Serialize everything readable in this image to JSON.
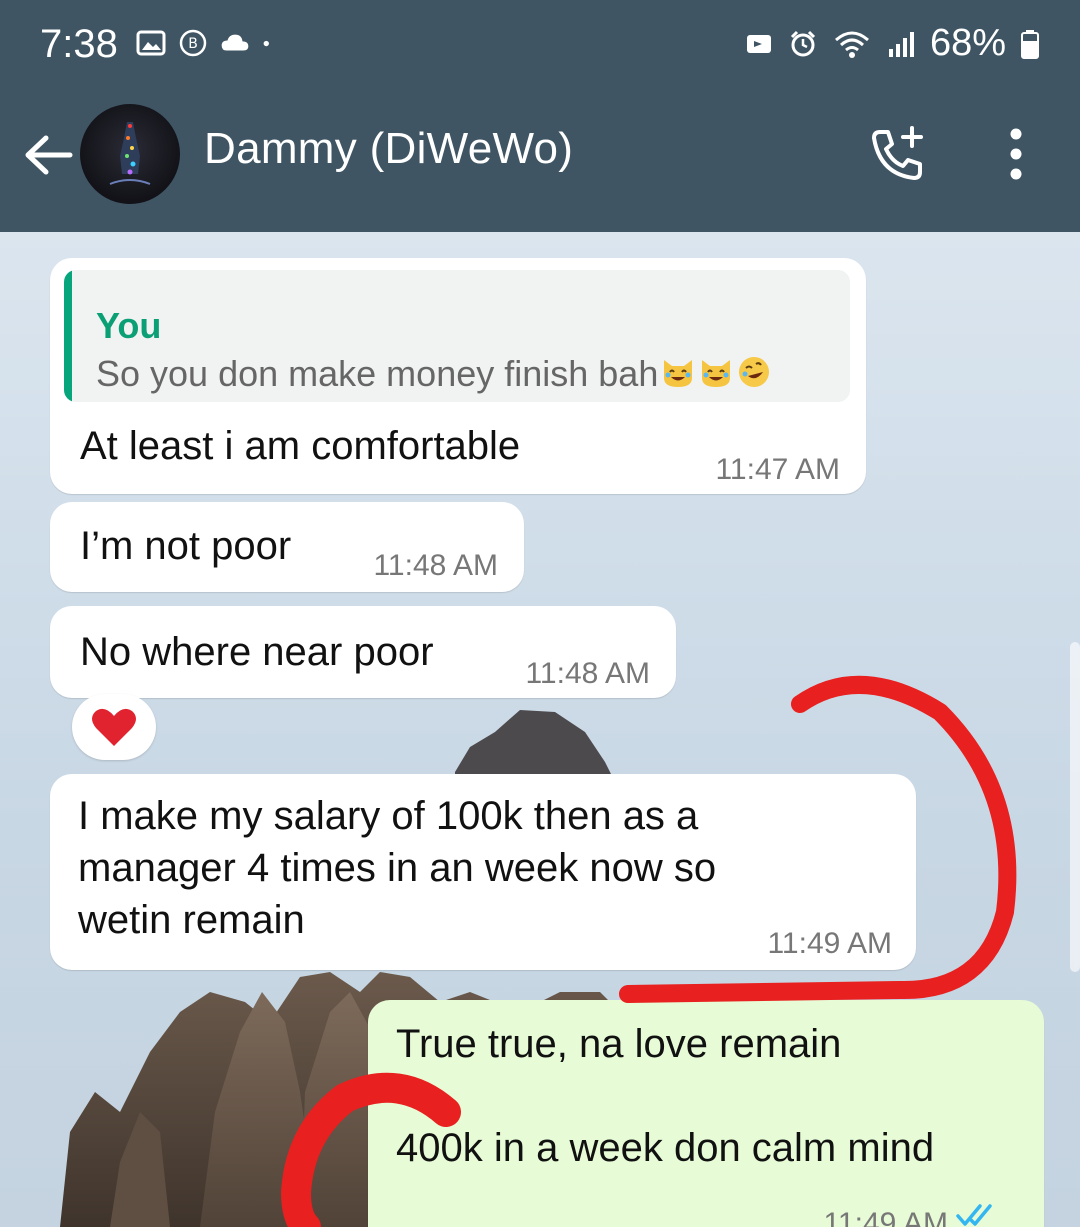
{
  "status_bar": {
    "time": "7:38",
    "left_icons": [
      "gallery-icon",
      "b-circle-icon",
      "cloud-icon",
      "dot-icon"
    ],
    "right_icons": [
      "notification-icon",
      "alarm-icon",
      "wifi-icon",
      "signal-icon"
    ],
    "battery_text": "68%"
  },
  "header": {
    "contact_name": "Dammy (DiWeWo)",
    "actions": [
      "call-add-icon",
      "menu-dots-icon"
    ]
  },
  "messages": [
    {
      "direction": "incoming",
      "quote": {
        "author": "You",
        "text": "So you don make money finish bah",
        "emojis": [
          "joy-cat-icon",
          "joy-cat-icon",
          "rolling-laugh-icon"
        ]
      },
      "text": "At least i am comfortable",
      "time": "11:47 AM"
    },
    {
      "direction": "incoming",
      "text": "I’m not poor",
      "time": "11:48 AM"
    },
    {
      "direction": "incoming",
      "text": "No where near poor",
      "time": "11:48 AM",
      "reaction": "heart"
    },
    {
      "direction": "incoming",
      "text": "I make my salary of 100k then as a\nmanager 4 times in an week now so\nwetin remain",
      "time": "11:49 AM"
    },
    {
      "direction": "outgoing",
      "text": "True true, na love remain\n\n400k in a week don calm mind",
      "time": "11:49 AM",
      "status": "read"
    }
  ],
  "colors": {
    "header_bg": "#3f5563",
    "outgoing_bubble": "#e7fbd6",
    "incoming_bubble": "#ffffff",
    "quote_accent": "#06a57c",
    "read_ticks": "#34b7f1",
    "annotation_red": "#e8201f",
    "reaction_heart": "#e0232e"
  }
}
